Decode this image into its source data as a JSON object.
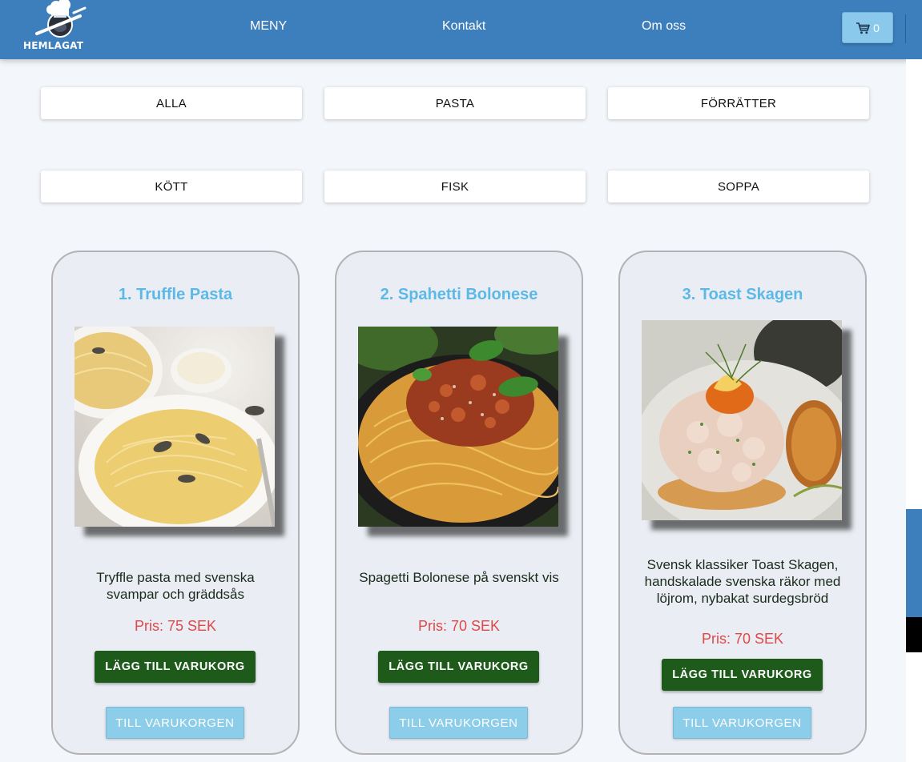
{
  "brand": {
    "name": "HEMLAGAT"
  },
  "nav": {
    "links": [
      {
        "label": "MENY"
      },
      {
        "label": "Kontakt"
      },
      {
        "label": "Om oss"
      }
    ],
    "cart": {
      "icon": "shopping-cart-icon",
      "count": "0"
    }
  },
  "categories": [
    {
      "label": "ALLA"
    },
    {
      "label": "PASTA"
    },
    {
      "label": "FÖRRÄTTER"
    },
    {
      "label": "KÖTT"
    },
    {
      "label": "FISK"
    },
    {
      "label": "SOPPA"
    }
  ],
  "products": [
    {
      "title": "1. Truffle Pasta",
      "description": "Tryffle pasta med svenska svampar och gräddsås",
      "price": "Pris: 75 SEK",
      "add_label": "LÄGG TILL VARUKORG",
      "goto_label": "TILL VARUKORGEN"
    },
    {
      "title": "2. Spahetti Bolonese",
      "description": "Spagetti Bolonese på svenskt vis",
      "price": "Pris: 70 SEK",
      "add_label": "LÄGG TILL VARUKORG",
      "goto_label": "TILL VARUKORGEN"
    },
    {
      "title": "3. Toast Skagen",
      "description": "Svensk klassiker Toast Skagen, handskalade svenska räkor med löjrom, nybakat surdegsbröd",
      "price": "Pris: 70 SEK",
      "add_label": "LÄGG TILL VARUKORG",
      "goto_label": "TILL VARUKORGEN"
    }
  ],
  "colors": {
    "navbar": "#3d7ebc",
    "title": "#5cb8e6",
    "price": "#e04848",
    "add_button": "#1e5a1a",
    "goto_button": "#8ccde9",
    "cart_button": "#8ac9ec"
  }
}
